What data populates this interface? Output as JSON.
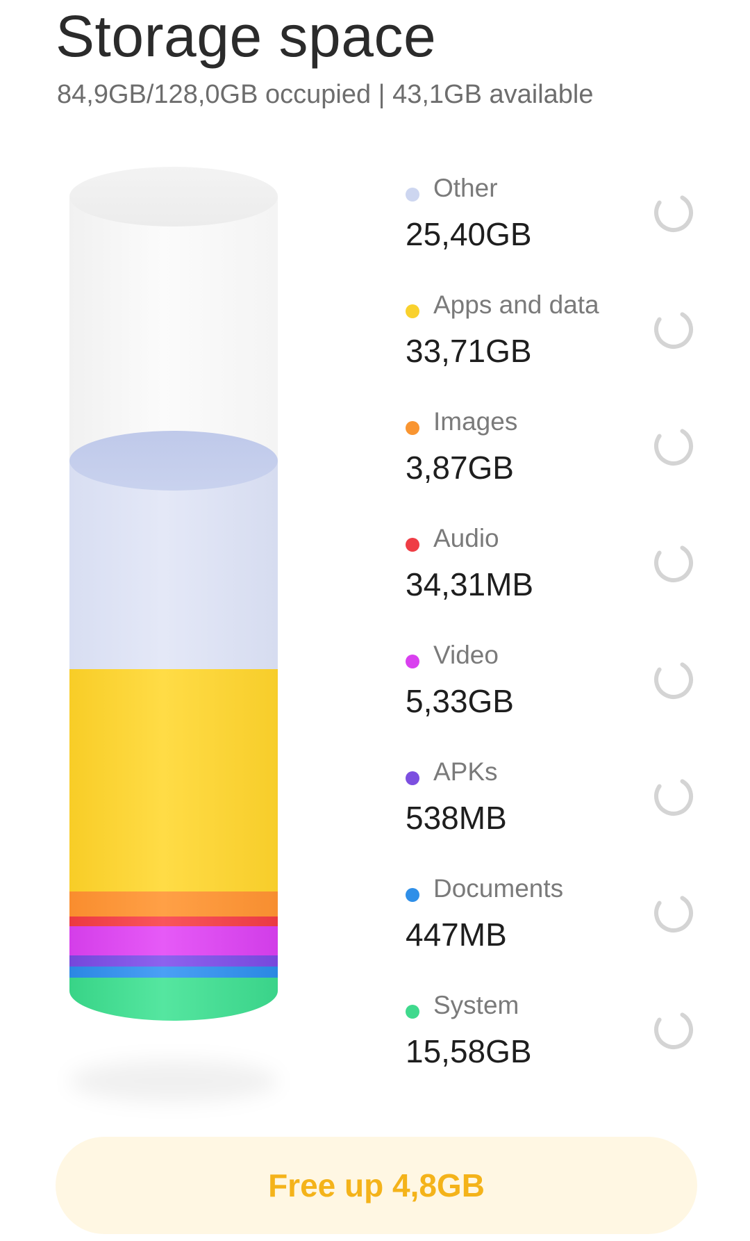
{
  "header": {
    "title": "Storage space",
    "subtitle": "84,9GB/128,0GB occupied | 43,1GB available"
  },
  "categories": [
    {
      "label": "Other",
      "value": "25,40GB",
      "color": "#cdd6f0"
    },
    {
      "label": "Apps and data",
      "value": "33,71GB",
      "color": "#f9d12d"
    },
    {
      "label": "Images",
      "value": "3,87GB",
      "color": "#f99531"
    },
    {
      "label": "Audio",
      "value": "34,31MB",
      "color": "#ef3d45"
    },
    {
      "label": "Video",
      "value": "5,33GB",
      "color": "#d940ef"
    },
    {
      "label": "APKs",
      "value": "538MB",
      "color": "#7c4fe0"
    },
    {
      "label": "Documents",
      "value": "447MB",
      "color": "#2f8fe8"
    },
    {
      "label": "System",
      "value": "15,58GB",
      "color": "#3fd98d"
    }
  ],
  "icons": {
    "loading": "loading-spinner-icon"
  },
  "actions": {
    "free_up_label": "Free up 4,8GB"
  }
}
